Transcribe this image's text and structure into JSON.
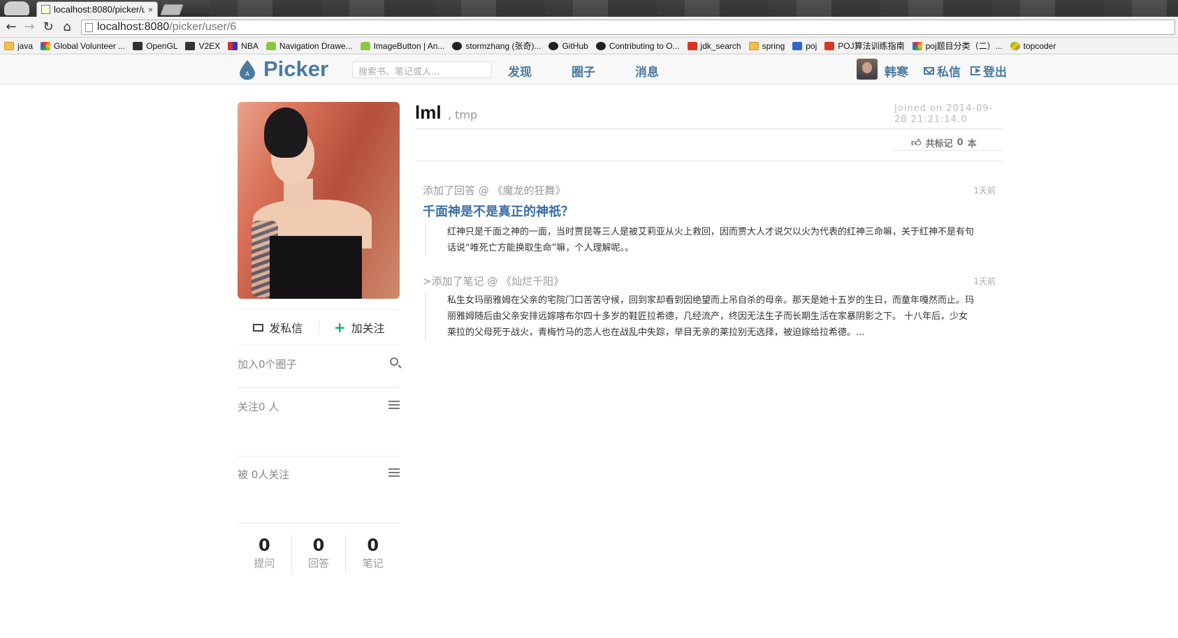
{
  "browser": {
    "tab_title": "localhost:8080/picker/u",
    "tab_close": "×",
    "url_host": "localhost:8080",
    "url_path": "/picker/user/6",
    "bookmarks": [
      {
        "label": "java",
        "icon": "folder"
      },
      {
        "label": "Global Volunteer ...",
        "icon": "multi"
      },
      {
        "label": "OpenGL",
        "icon": "dark"
      },
      {
        "label": "V2EX",
        "icon": "dark"
      },
      {
        "label": "NBA",
        "icon": "nba"
      },
      {
        "label": "Navigation Drawe...",
        "icon": "android"
      },
      {
        "label": "ImageButton | An...",
        "icon": "android"
      },
      {
        "label": "stormzhang (张奇)...",
        "icon": "gh"
      },
      {
        "label": "GitHub",
        "icon": "gh"
      },
      {
        "label": "Contributing to O...",
        "icon": "gh"
      },
      {
        "label": "jdk_search",
        "icon": "red"
      },
      {
        "label": "spring",
        "icon": "folder"
      },
      {
        "label": "poj",
        "icon": "blue"
      },
      {
        "label": "POJ算法训练指南",
        "icon": "red"
      },
      {
        "label": "poj题目分类（二）...",
        "icon": "multi"
      },
      {
        "label": "topcoder",
        "icon": "tc"
      }
    ]
  },
  "site": {
    "logo_letter": "A",
    "logo_text": "Picker",
    "search_placeholder": "搜索书、笔记或人...",
    "nav": [
      "发现",
      "圈子",
      "消息"
    ],
    "user_name": "韩寒",
    "messages_label": "私信",
    "logout_label": "登出",
    "accent": "#4b7aa0"
  },
  "profile": {
    "name": "lml",
    "subtitle": ", tmp",
    "joined": "Joined on 2014-09-28 21:21:14.0",
    "marks_prefix": "共标记",
    "marks_count": "0",
    "marks_suffix": "本",
    "send_message": "发私信",
    "follow": "加关注",
    "circles": "加入0个圈子",
    "following": "关注0 人",
    "followers": "被 0人关注",
    "stats": [
      {
        "value": "0",
        "label": "提问"
      },
      {
        "value": "0",
        "label": "回答"
      },
      {
        "value": "0",
        "label": "笔记"
      }
    ]
  },
  "feed": [
    {
      "meta": "添加了回答 @ 《魔龙的狂舞》",
      "time": "1天前",
      "title": "千面神是不是真正的神祇？",
      "body": "红神只是千面之神的一面，当时贾昆等三人是被艾莉亚从火上救回，因而贾大人才说欠以火为代表的红神三命嘛，关于红神不是有句话说“唯死亡方能换取生命”嘛，个人理解呢。。"
    },
    {
      "meta": ">添加了笔记 @ 《灿烂千阳》",
      "time": "1天前",
      "title": "",
      "body": "私生女玛丽雅姆在父亲的宅院门口苦苦守候，回到家却看到因绝望而上吊自杀的母亲。那天是她十五岁的生日，而童年嘎然而止。玛丽雅姆随后由父亲安排远嫁喀布尔四十多岁的鞋匠拉希德，几经流产，终因无法生子而长期生活在家暴阴影之下。 十八年后，少女莱拉的父母死于战火，青梅竹马的恋人也在战乱中失踪，举目无亲的莱拉别无选择，被迫嫁给拉希德。..."
    }
  ]
}
